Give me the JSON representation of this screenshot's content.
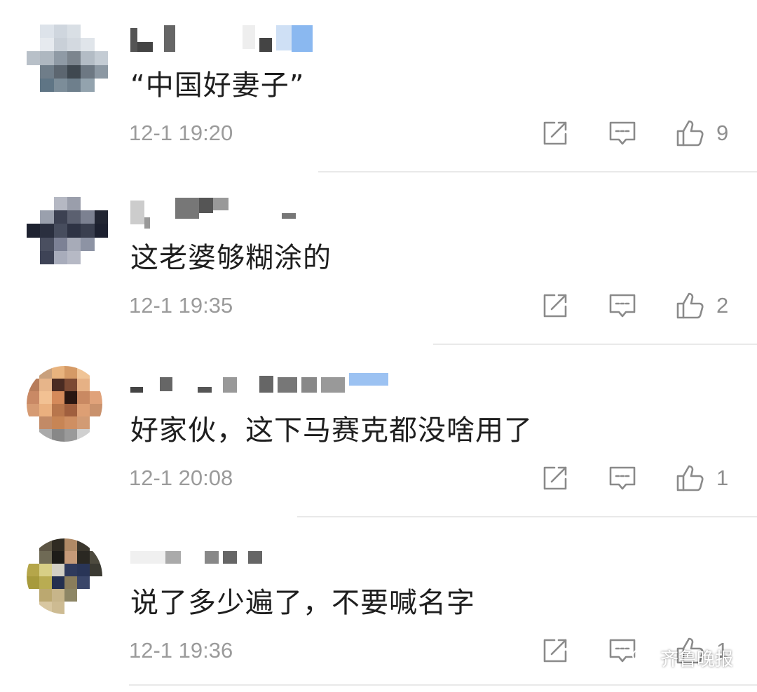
{
  "comments": [
    {
      "text": "“中国好妻子”",
      "time": "12-1 19:20",
      "likes": "9"
    },
    {
      "text": "这老婆够糊涂的",
      "time": "12-1 19:35",
      "likes": "2"
    },
    {
      "text": "好家伙，这下马赛克都没啥用了",
      "time": "12-1 20:08",
      "likes": "1"
    },
    {
      "text": "说了多少遍了，不要喊名字",
      "time": "12-1 19:36",
      "likes": "1"
    }
  ],
  "icons": {
    "share": "share-icon",
    "reply": "comment-icon",
    "like": "thumbs-up-icon"
  },
  "watermark": {
    "text": "齐鲁晚报"
  },
  "colors": {
    "text": "#1e1e1e",
    "meta": "#9b9b9b",
    "divider": "#e9e9e9"
  }
}
